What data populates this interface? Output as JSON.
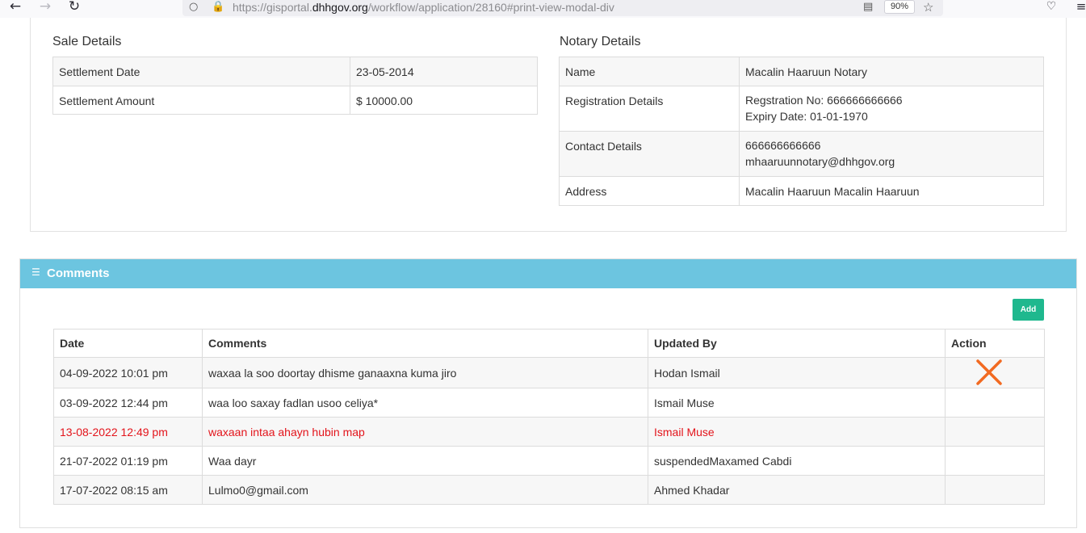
{
  "browser": {
    "url_prefix": "https://gisportal.",
    "url_host": "dhhgov.org",
    "url_path": "/workflow/application/28160#print-view-modal-div",
    "zoom": "90%"
  },
  "sale": {
    "heading": "Sale Details",
    "rows": [
      {
        "label": "Settlement Date",
        "value": "23-05-2014"
      },
      {
        "label": "Settlement Amount",
        "value": "$ 10000.00"
      }
    ]
  },
  "notary": {
    "heading": "Notary Details",
    "name_label": "Name",
    "name_value": "Macalin Haaruun Notary",
    "registration_label": "Registration Details",
    "registration_no": "Regstration No: 666666666666",
    "expiry": "Expiry Date: 01-01-1970",
    "contact_label": "Contact Details",
    "contact_phone": "666666666666",
    "contact_email": "mhaaruunnotary@dhhgov.org",
    "address_label": "Address",
    "address_value": "Macalin Haaruun Macalin Haaruun"
  },
  "comments": {
    "title": "Comments",
    "add_label": "Add",
    "columns": [
      "Date",
      "Comments",
      "Updated By",
      "Action"
    ],
    "rows": [
      {
        "date": "04-09-2022 10:01 pm",
        "comment": "waxaa la soo doortay dhisme ganaaxna kuma jiro",
        "by": "Hodan Ismail"
      },
      {
        "date": "03-09-2022 12:44 pm",
        "comment": "waa loo saxay fadlan usoo celiya*",
        "by": "Ismail Muse"
      },
      {
        "date": "13-08-2022 12:49 pm",
        "comment": "waxaan intaa ahayn hubin map",
        "by": "Ismail Muse"
      },
      {
        "date": "21-07-2022 01:19 pm",
        "comment": "Waa dayr",
        "by": "suspendedMaxamed Cabdi"
      },
      {
        "date": "17-07-2022 08:15 am",
        "comment": "Lulmo0@gmail.com",
        "by": "Ahmed Khadar"
      }
    ]
  },
  "colors": {
    "header": "#6cc5e0",
    "add_button": "#1fb88e",
    "highlight_text": "#e3141b",
    "delete_icon": "#f26a21"
  }
}
